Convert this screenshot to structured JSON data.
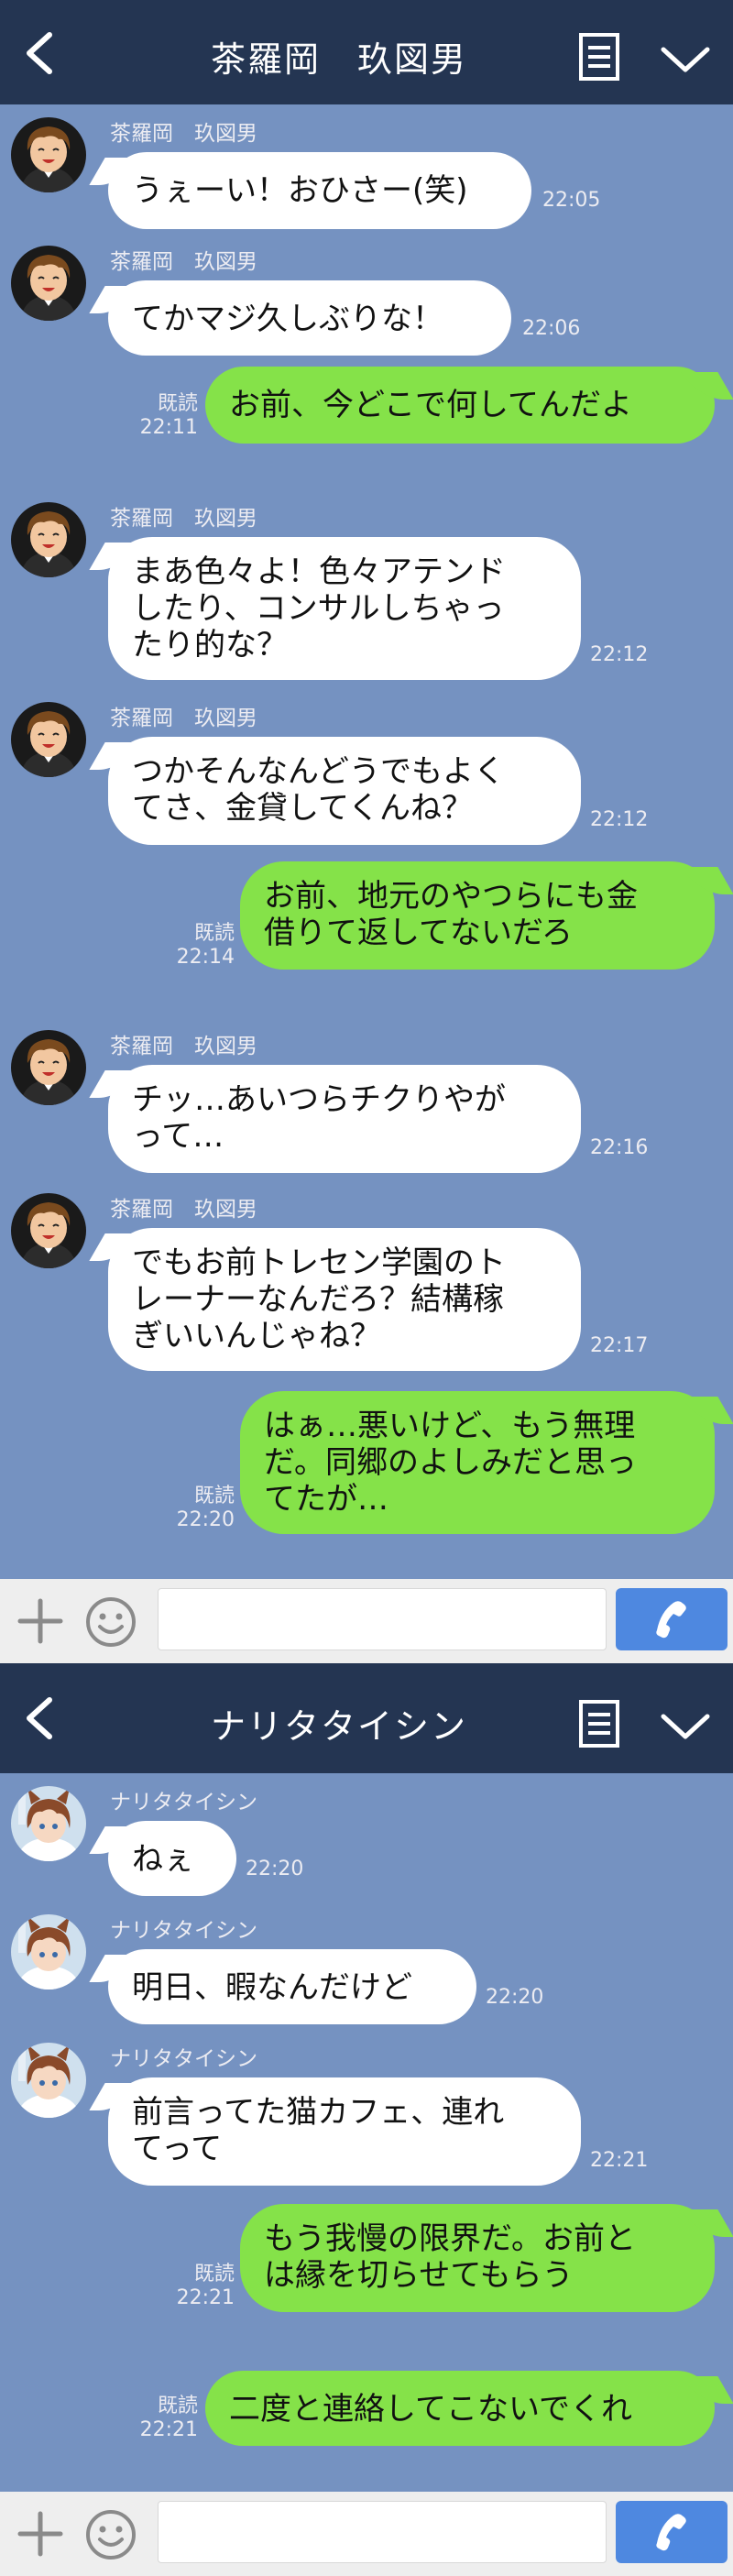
{
  "screens": [
    {
      "title": "茶羅岡　玖図男",
      "messages": [
        {
          "side": "in",
          "sender": "茶羅岡　玖図男",
          "text": "うぇーい！おひさー(笑)",
          "time": "22:05"
        },
        {
          "side": "in",
          "sender": "茶羅岡　玖図男",
          "text": "てかマジ久しぶりな！",
          "time": "22:06"
        },
        {
          "side": "out",
          "read": "既読",
          "text": "お前、今どこで何してんだよ",
          "time": "22:11"
        },
        {
          "side": "in",
          "sender": "茶羅岡　玖図男",
          "text": "まあ色々よ！色々アテンド\nしたり、コンサルしちゃっ\nたり的な？",
          "time": "22:12"
        },
        {
          "side": "in",
          "sender": "茶羅岡　玖図男",
          "text": "つかそんなんどうでもよく\nてさ、金貸してくんね？",
          "time": "22:12"
        },
        {
          "side": "out",
          "read": "既読",
          "text": "お前、地元のやつらにも金\n借りて返してないだろ",
          "time": "22:14"
        },
        {
          "side": "in",
          "sender": "茶羅岡　玖図男",
          "text": "チッ…あいつらチクりやが\nって…",
          "time": "22:16"
        },
        {
          "side": "in",
          "sender": "茶羅岡　玖図男",
          "text": "でもお前トレセン学園のト\nレーナーなんだろ？結構稼\nぎいいんじゃね？",
          "time": "22:17"
        },
        {
          "side": "out",
          "read": "既読",
          "text": "はぁ…悪いけど、もう無理\nだ。同郷のよしみだと思っ\nてたが…",
          "time": "22:20"
        }
      ]
    },
    {
      "title": "ナリタタイシン",
      "messages": [
        {
          "side": "in",
          "sender": "ナリタタイシン",
          "text": "ねぇ",
          "time": "22:20"
        },
        {
          "side": "in",
          "sender": "ナリタタイシン",
          "text": "明日、暇なんだけど",
          "time": "22:20"
        },
        {
          "side": "in",
          "sender": "ナリタタイシン",
          "text": "前言ってた猫カフェ、連れ\nてって",
          "time": "22:21"
        },
        {
          "side": "out",
          "read": "既読",
          "text": "もう我慢の限界だ。お前と\nは縁を切らせてもらう",
          "time": "22:21"
        },
        {
          "side": "out",
          "read": "既読",
          "text": "二度と連絡してこないでくれ",
          "time": "22:21"
        }
      ]
    }
  ],
  "icons": {
    "back": "back-chevron-icon",
    "menu": "notes-menu-icon",
    "collapse": "chevron-down-icon",
    "add": "plus-icon",
    "sticker": "smiley-icon",
    "call": "phone-icon"
  },
  "colors": {
    "header": "#243552",
    "background": "#7592c1",
    "outgoing": "#85e249",
    "incoming": "#ffffff",
    "call_button": "#4e88e0"
  }
}
